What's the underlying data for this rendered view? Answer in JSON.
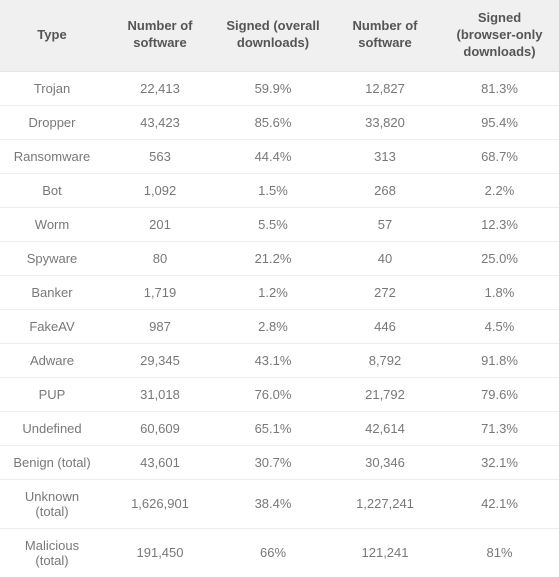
{
  "table": {
    "headers": {
      "type": "Type",
      "num_software_overall": "Number of software",
      "signed_overall": "Signed (overall downloads)",
      "num_software_browser": "Number of software",
      "signed_browser": "Signed (browser-only downloads)"
    },
    "rows": [
      {
        "type": "Trojan",
        "num_overall": "22,413",
        "signed_overall": "59.9%",
        "num_browser": "12,827",
        "signed_browser": "81.3%"
      },
      {
        "type": "Dropper",
        "num_overall": "43,423",
        "signed_overall": "85.6%",
        "num_browser": "33,820",
        "signed_browser": "95.4%"
      },
      {
        "type": "Ransomware",
        "num_overall": "563",
        "signed_overall": "44.4%",
        "num_browser": "313",
        "signed_browser": "68.7%"
      },
      {
        "type": "Bot",
        "num_overall": "1,092",
        "signed_overall": "1.5%",
        "num_browser": "268",
        "signed_browser": "2.2%"
      },
      {
        "type": "Worm",
        "num_overall": "201",
        "signed_overall": "5.5%",
        "num_browser": "57",
        "signed_browser": "12.3%"
      },
      {
        "type": "Spyware",
        "num_overall": "80",
        "signed_overall": "21.2%",
        "num_browser": "40",
        "signed_browser": "25.0%"
      },
      {
        "type": "Banker",
        "num_overall": "1,719",
        "signed_overall": "1.2%",
        "num_browser": "272",
        "signed_browser": "1.8%"
      },
      {
        "type": "FakeAV",
        "num_overall": "987",
        "signed_overall": "2.8%",
        "num_browser": "446",
        "signed_browser": "4.5%"
      },
      {
        "type": "Adware",
        "num_overall": "29,345",
        "signed_overall": "43.1%",
        "num_browser": "8,792",
        "signed_browser": "91.8%"
      },
      {
        "type": "PUP",
        "num_overall": "31,018",
        "signed_overall": "76.0%",
        "num_browser": "21,792",
        "signed_browser": "79.6%"
      },
      {
        "type": "Undefined",
        "num_overall": "60,609",
        "signed_overall": "65.1%",
        "num_browser": "42,614",
        "signed_browser": "71.3%"
      },
      {
        "type": "Benign (total)",
        "num_overall": "43,601",
        "signed_overall": "30.7%",
        "num_browser": "30,346",
        "signed_browser": "32.1%"
      },
      {
        "type": "Unknown (total)",
        "num_overall": "1,626,901",
        "signed_overall": "38.4%",
        "num_browser": "1,227,241",
        "signed_browser": "42.1%"
      },
      {
        "type": "Malicious (total)",
        "num_overall": "191,450",
        "signed_overall": "66%",
        "num_browser": "121,241",
        "signed_browser": "81%"
      }
    ]
  }
}
